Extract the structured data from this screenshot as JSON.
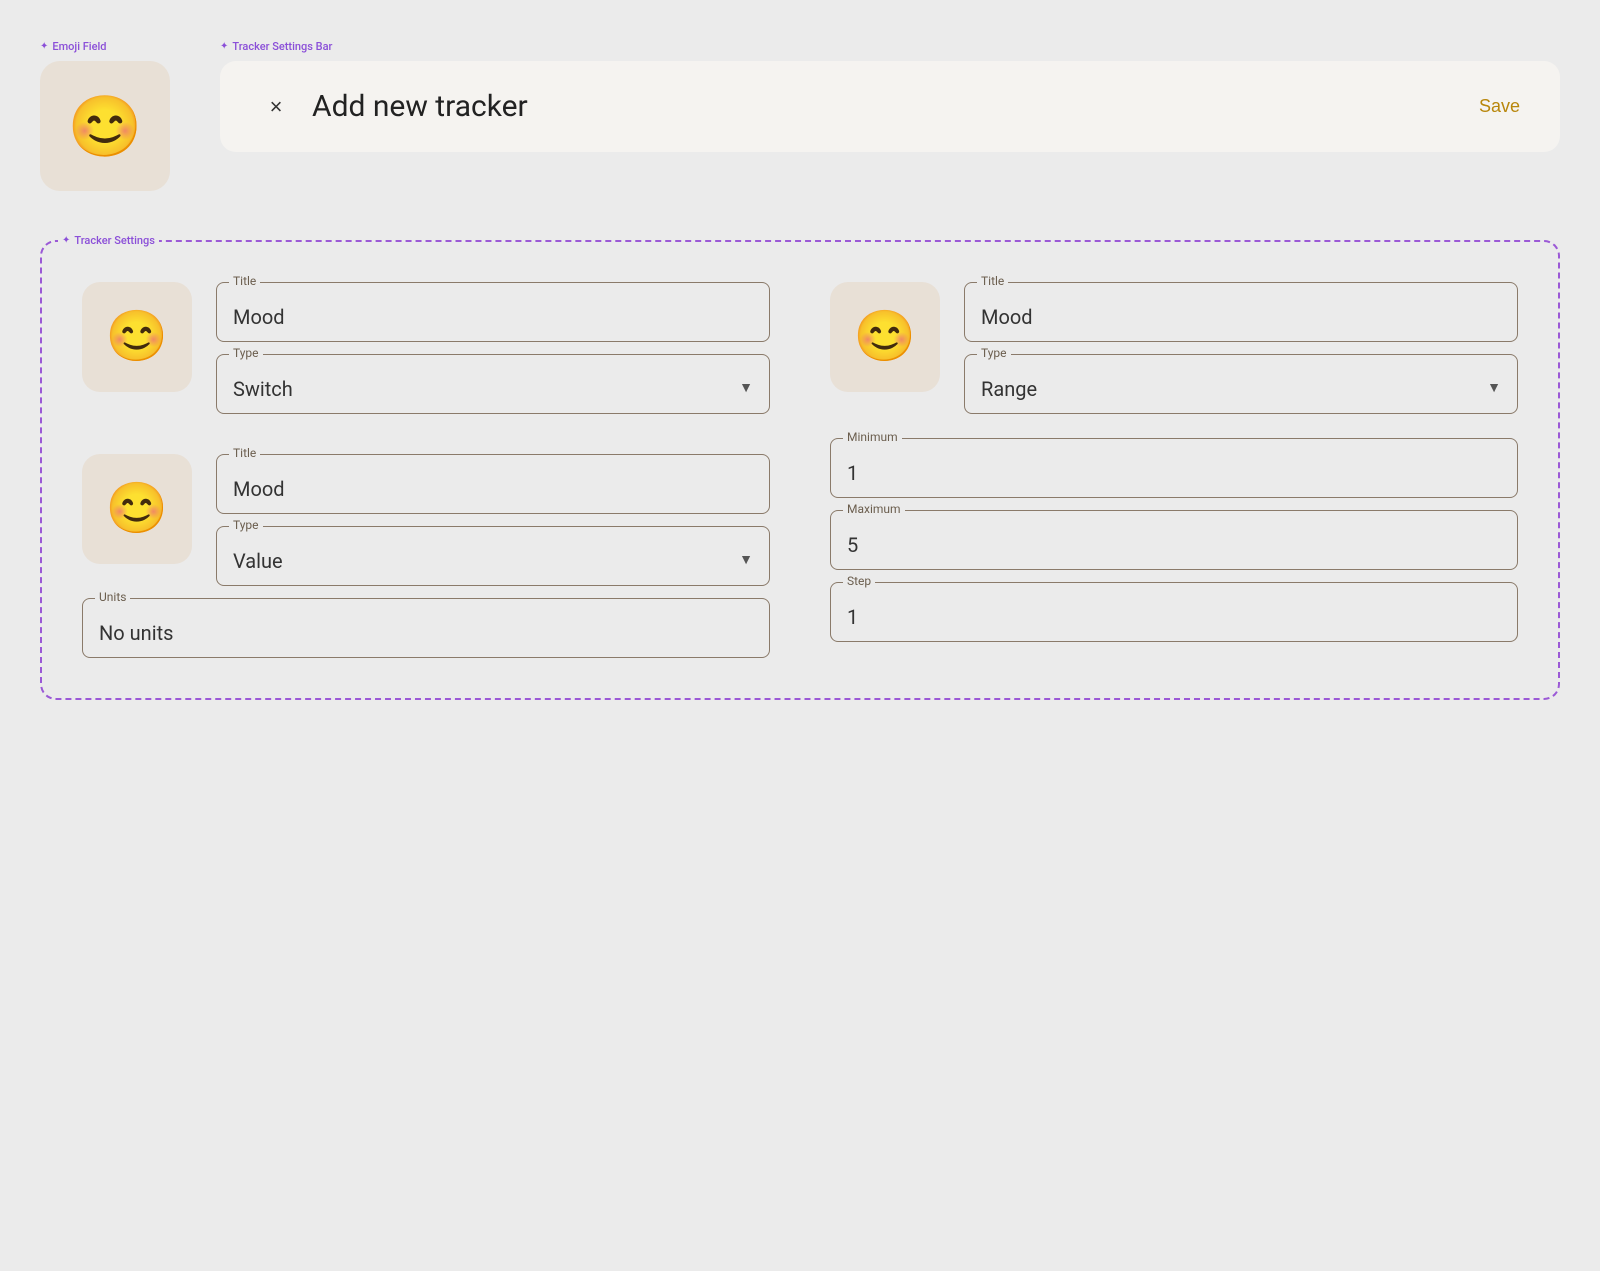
{
  "emoji_field": {
    "label": "Emoji Field",
    "emoji": "😊"
  },
  "tracker_settings_bar": {
    "label": "Tracker Settings Bar",
    "close_icon": "×",
    "title": "Add new tracker",
    "save_label": "Save"
  },
  "tracker_settings": {
    "label": "Tracker Settings",
    "item1": {
      "emoji": "😊",
      "title_label": "Title",
      "title_value": "Mood",
      "type_label": "Type",
      "type_value": "Switch"
    },
    "item2": {
      "emoji": "😊",
      "title_label": "Title",
      "title_value": "Mood",
      "type_label": "Type",
      "type_value": "Value",
      "units_label": "Units",
      "units_value": "No units"
    },
    "item3": {
      "emoji": "😊",
      "title_label": "Title",
      "title_value": "Mood",
      "type_label": "Type",
      "type_value": "Range",
      "minimum_label": "Minimum",
      "minimum_value": "1",
      "maximum_label": "Maximum",
      "maximum_value": "5",
      "step_label": "Step",
      "step_value": "1"
    }
  }
}
